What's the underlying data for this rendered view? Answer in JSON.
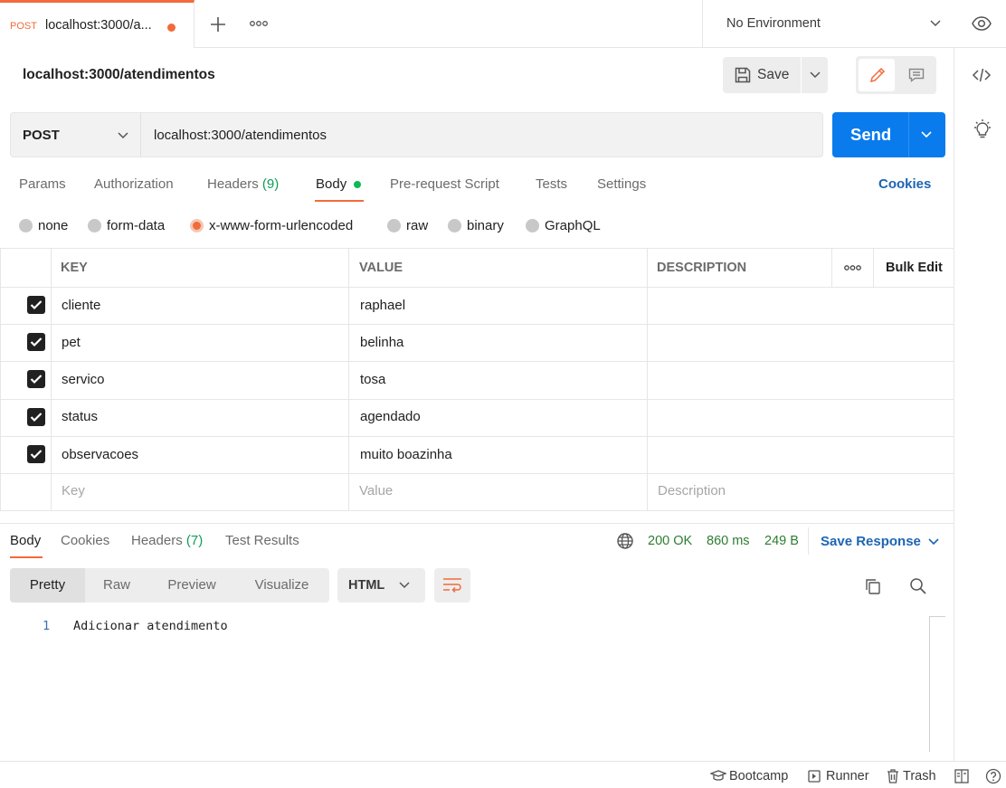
{
  "tab": {
    "method": "POST",
    "title": "localhost:3000/a..."
  },
  "environment": {
    "label": "No Environment"
  },
  "request": {
    "title": "localhost:3000/atendimentos",
    "save_label": "Save",
    "method": "POST",
    "url": "localhost:3000/atendimentos",
    "send_label": "Send"
  },
  "request_tabs": {
    "params": "Params",
    "authorization": "Authorization",
    "headers": "Headers",
    "headers_count": "(9)",
    "body": "Body",
    "prerequest": "Pre-request Script",
    "tests": "Tests",
    "settings": "Settings",
    "cookies": "Cookies"
  },
  "body_types": [
    {
      "label": "none",
      "selected": false
    },
    {
      "label": "form-data",
      "selected": false
    },
    {
      "label": "x-www-form-urlencoded",
      "selected": true
    },
    {
      "label": "raw",
      "selected": false
    },
    {
      "label": "binary",
      "selected": false
    },
    {
      "label": "GraphQL",
      "selected": false
    }
  ],
  "table": {
    "headers": {
      "key": "KEY",
      "value": "VALUE",
      "description": "DESCRIPTION",
      "bulk_edit": "Bulk Edit"
    },
    "rows": [
      {
        "key": "cliente",
        "value": "raphael",
        "checked": true
      },
      {
        "key": "pet",
        "value": "belinha",
        "checked": true
      },
      {
        "key": "servico",
        "value": "tosa",
        "checked": true
      },
      {
        "key": "status",
        "value": "agendado",
        "checked": true
      },
      {
        "key": "observacoes",
        "value": "muito boazinha",
        "checked": true
      }
    ],
    "placeholders": {
      "key": "Key",
      "value": "Value",
      "description": "Description"
    }
  },
  "response": {
    "tabs": {
      "body": "Body",
      "cookies": "Cookies",
      "headers": "Headers",
      "headers_count": "(7)",
      "test_results": "Test Results"
    },
    "status": "200 OK",
    "time": "860 ms",
    "size": "249 B",
    "save_response": "Save Response",
    "views": {
      "pretty": "Pretty",
      "raw": "Raw",
      "preview": "Preview",
      "visualize": "Visualize"
    },
    "language": "HTML",
    "lines": [
      {
        "num": "1",
        "text": "Adicionar atendimento"
      }
    ]
  },
  "footer": {
    "bootcamp": "Bootcamp",
    "runner": "Runner",
    "trash": "Trash"
  }
}
